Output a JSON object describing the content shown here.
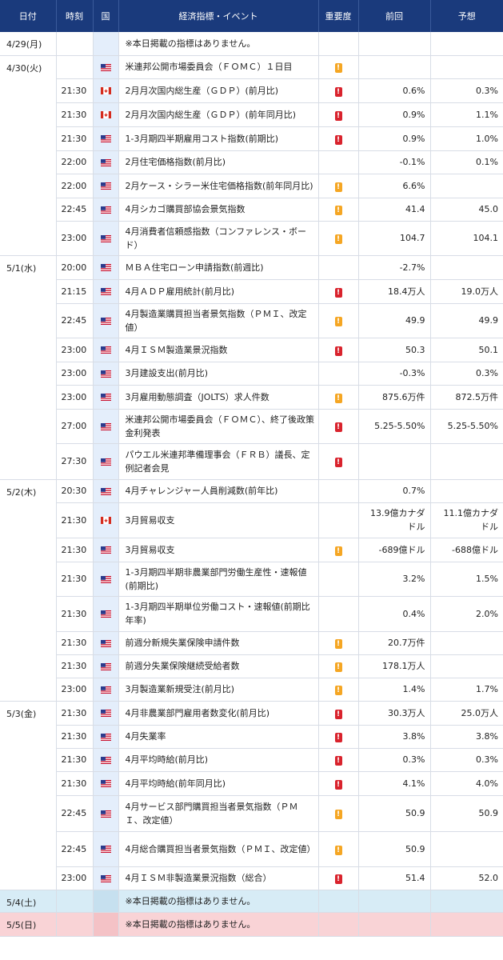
{
  "header": {
    "date": "日付",
    "time": "時刻",
    "country": "国",
    "event": "経済指標・イベント",
    "importance": "重要度",
    "previous": "前回",
    "forecast": "予想"
  },
  "colors": {
    "header_bg": "#1a3a7c",
    "importance_medium": "#f5a623",
    "importance_high": "#d9232d",
    "saturday_bg": "#d7ecf6",
    "sunday_bg": "#f9d3d6"
  },
  "importance_mark": "!",
  "days": [
    {
      "date": "4/29(月)",
      "type": "weekday",
      "rows": [
        {
          "time": "",
          "country": "",
          "event": "※本日掲載の指標はありません。",
          "importance": "",
          "previous": "",
          "forecast": ""
        }
      ]
    },
    {
      "date": "4/30(火)",
      "type": "weekday",
      "rows": [
        {
          "time": "",
          "country": "US",
          "event": "米連邦公開市場委員会（ＦＯＭＣ）１日目",
          "importance": "medium",
          "previous": "",
          "forecast": ""
        },
        {
          "time": "21:30",
          "country": "CA",
          "event": "2月月次国内総生産（ＧＤＰ）(前月比)",
          "importance": "high",
          "previous": "0.6%",
          "forecast": "0.3%"
        },
        {
          "time": "21:30",
          "country": "CA",
          "event": "2月月次国内総生産（ＧＤＰ）(前年同月比)",
          "importance": "high",
          "previous": "0.9%",
          "forecast": "1.1%"
        },
        {
          "time": "21:30",
          "country": "US",
          "event": "1-3月期四半期雇用コスト指数(前期比)",
          "importance": "high",
          "previous": "0.9%",
          "forecast": "1.0%"
        },
        {
          "time": "22:00",
          "country": "US",
          "event": "2月住宅価格指数(前月比)",
          "importance": "",
          "previous": "-0.1%",
          "forecast": "0.1%"
        },
        {
          "time": "22:00",
          "country": "US",
          "event": "2月ケース・シラー米住宅価格指数(前年同月比)",
          "importance": "medium",
          "previous": "6.6%",
          "forecast": ""
        },
        {
          "time": "22:45",
          "country": "US",
          "event": "4月シカゴ購買部協会景気指数",
          "importance": "medium",
          "previous": "41.4",
          "forecast": "45.0"
        },
        {
          "time": "23:00",
          "country": "US",
          "event": "4月消費者信頼感指数（コンファレンス・ボード）",
          "importance": "medium",
          "previous": "104.7",
          "forecast": "104.1"
        }
      ]
    },
    {
      "date": "5/1(水)",
      "type": "weekday",
      "rows": [
        {
          "time": "20:00",
          "country": "US",
          "event": "ＭＢＡ住宅ローン申請指数(前週比)",
          "importance": "",
          "previous": "-2.7%",
          "forecast": ""
        },
        {
          "time": "21:15",
          "country": "US",
          "event": "4月ＡＤＰ雇用統計(前月比)",
          "importance": "high",
          "previous": "18.4万人",
          "forecast": "19.0万人"
        },
        {
          "time": "22:45",
          "country": "US",
          "event": "4月製造業購買担当者景気指数（ＰＭＩ、改定値）",
          "importance": "medium",
          "previous": "49.9",
          "forecast": "49.9"
        },
        {
          "time": "23:00",
          "country": "US",
          "event": "4月ＩＳＭ製造業景況指数",
          "importance": "high",
          "previous": "50.3",
          "forecast": "50.1"
        },
        {
          "time": "23:00",
          "country": "US",
          "event": "3月建設支出(前月比)",
          "importance": "",
          "previous": "-0.3%",
          "forecast": "0.3%"
        },
        {
          "time": "23:00",
          "country": "US",
          "event": "3月雇用動態調査（JOLTS）求人件数",
          "importance": "medium",
          "previous": "875.6万件",
          "forecast": "872.5万件"
        },
        {
          "time": "27:00",
          "country": "US",
          "event": "米連邦公開市場委員会（ＦＯＭＣ）、終了後政策金利発表",
          "importance": "high",
          "previous": "5.25-5.50%",
          "forecast": "5.25-5.50%"
        },
        {
          "time": "27:30",
          "country": "US",
          "event": "パウエル米連邦準備理事会（ＦＲＢ）議長、定例記者会見",
          "importance": "high",
          "previous": "",
          "forecast": ""
        }
      ]
    },
    {
      "date": "5/2(木)",
      "type": "weekday",
      "rows": [
        {
          "time": "20:30",
          "country": "US",
          "event": "4月チャレンジャー人員削減数(前年比)",
          "importance": "",
          "previous": "0.7%",
          "forecast": ""
        },
        {
          "time": "21:30",
          "country": "CA",
          "event": "3月貿易収支",
          "importance": "",
          "previous": "13.9億カナダドル",
          "forecast": "11.1億カナダドル"
        },
        {
          "time": "21:30",
          "country": "US",
          "event": "3月貿易収支",
          "importance": "medium",
          "previous": "-689億ドル",
          "forecast": "-688億ドル"
        },
        {
          "time": "21:30",
          "country": "US",
          "event": "1-3月期四半期非農業部門労働生産性・速報値(前期比)",
          "importance": "",
          "previous": "3.2%",
          "forecast": "1.5%"
        },
        {
          "time": "21:30",
          "country": "US",
          "event": "1-3月期四半期単位労働コスト・速報値(前期比年率)",
          "importance": "",
          "previous": "0.4%",
          "forecast": "2.0%"
        },
        {
          "time": "21:30",
          "country": "US",
          "event": "前週分新規失業保険申請件数",
          "importance": "medium",
          "previous": "20.7万件",
          "forecast": ""
        },
        {
          "time": "21:30",
          "country": "US",
          "event": "前週分失業保険継続受給者数",
          "importance": "medium",
          "previous": "178.1万人",
          "forecast": ""
        },
        {
          "time": "23:00",
          "country": "US",
          "event": "3月製造業新規受注(前月比)",
          "importance": "medium",
          "previous": "1.4%",
          "forecast": "1.7%"
        }
      ]
    },
    {
      "date": "5/3(金)",
      "type": "weekday",
      "rows": [
        {
          "time": "21:30",
          "country": "US",
          "event": "4月非農業部門雇用者数変化(前月比)",
          "importance": "high",
          "previous": "30.3万人",
          "forecast": "25.0万人"
        },
        {
          "time": "21:30",
          "country": "US",
          "event": "4月失業率",
          "importance": "high",
          "previous": "3.8%",
          "forecast": "3.8%"
        },
        {
          "time": "21:30",
          "country": "US",
          "event": "4月平均時給(前月比)",
          "importance": "high",
          "previous": "0.3%",
          "forecast": "0.3%"
        },
        {
          "time": "21:30",
          "country": "US",
          "event": "4月平均時給(前年同月比)",
          "importance": "high",
          "previous": "4.1%",
          "forecast": "4.0%"
        },
        {
          "time": "22:45",
          "country": "US",
          "event": "4月サービス部門購買担当者景気指数（ＰＭＩ、改定値）",
          "importance": "medium",
          "previous": "50.9",
          "forecast": "50.9"
        },
        {
          "time": "22:45",
          "country": "US",
          "event": "4月総合購買担当者景気指数（ＰＭＩ、改定値）",
          "importance": "medium",
          "previous": "50.9",
          "forecast": ""
        },
        {
          "time": "23:00",
          "country": "US",
          "event": "4月ＩＳＭ非製造業景況指数（総合）",
          "importance": "high",
          "previous": "51.4",
          "forecast": "52.0"
        }
      ]
    },
    {
      "date": "5/4(土)",
      "type": "saturday",
      "rows": [
        {
          "time": "",
          "country": "",
          "event": "※本日掲載の指標はありません。",
          "importance": "",
          "previous": "",
          "forecast": ""
        }
      ]
    },
    {
      "date": "5/5(日)",
      "type": "sunday",
      "rows": [
        {
          "time": "",
          "country": "",
          "event": "※本日掲載の指標はありません。",
          "importance": "",
          "previous": "",
          "forecast": ""
        }
      ]
    }
  ]
}
